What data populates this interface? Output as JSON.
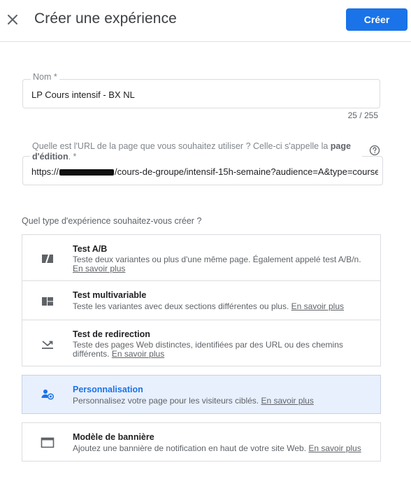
{
  "header": {
    "title": "Créer une expérience",
    "create_label": "Créer"
  },
  "name_field": {
    "label": "Nom *",
    "value": "LP Cours intensif - BX NL",
    "counter": "25 / 255"
  },
  "url_field": {
    "label_prefix": "Quelle est l'URL de la page que vous souhaitez utiliser ? Celle-ci s'appelle la ",
    "label_bold": "page d'édition",
    "label_suffix": ". *",
    "value_prefix": "https://",
    "value_suffix": "/cours-de-groupe/intensif-15h-semaine?audience=A&type=course"
  },
  "experience_types": {
    "title": "Quel type d'expérience souhaitez-vous créer ?",
    "learn_more": "En savoir plus",
    "options": [
      {
        "title": "Test A/B",
        "description": "Teste deux variantes ou plus d'une même page. Également appelé test A/B/n.",
        "icon": "ab-test-icon"
      },
      {
        "title": "Test multivariable",
        "description": "Teste les variantes avec deux sections différentes ou plus.",
        "icon": "multivariate-icon"
      },
      {
        "title": "Test de redirection",
        "description": "Teste des pages Web distinctes, identifiées par des URL ou des chemins différents.",
        "icon": "redirect-icon"
      },
      {
        "title": "Personnalisation",
        "description": "Personnalisez votre page pour les visiteurs ciblés.",
        "icon": "personalization-icon"
      },
      {
        "title": "Modèle de bannière",
        "description": "Ajoutez une bannière de notification en haut de votre site Web.",
        "icon": "banner-icon"
      }
    ]
  },
  "colors": {
    "accent": "#1a73e8",
    "selected_bg": "#e8f0fe"
  }
}
